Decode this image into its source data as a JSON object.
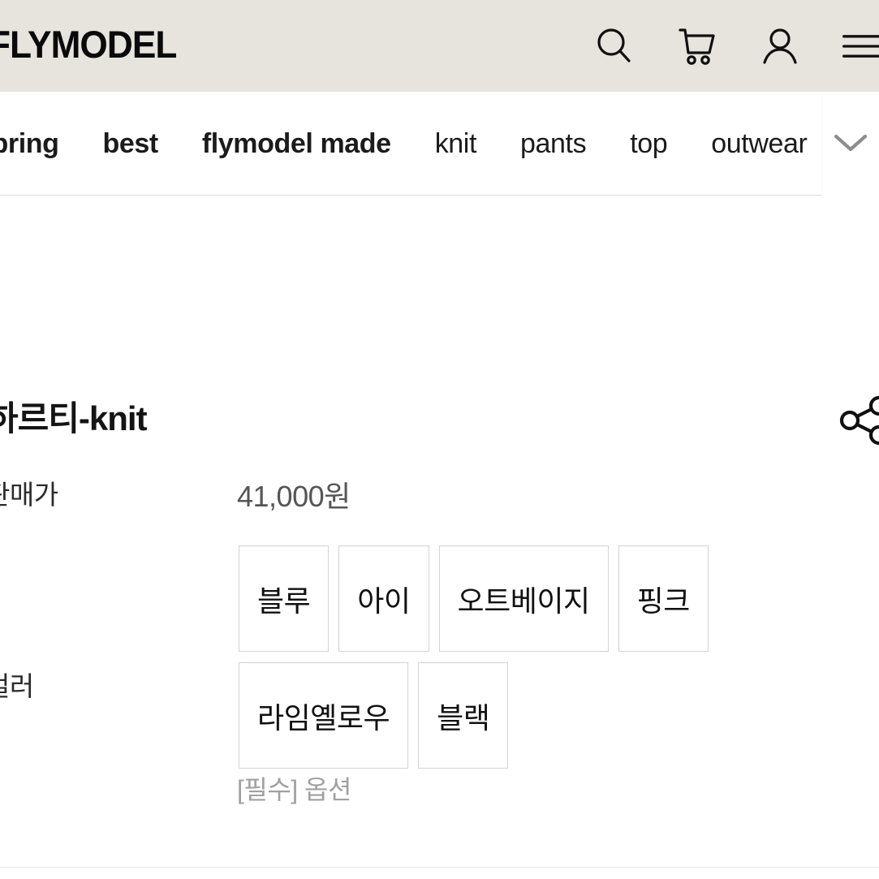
{
  "header": {
    "brand": "FLYMODEL",
    "background_color": "#e7e4dd",
    "icons": [
      {
        "name": "search-icon",
        "label": "Search"
      },
      {
        "name": "cart-icon",
        "label": "Cart"
      },
      {
        "name": "account-icon",
        "label": "My Account"
      },
      {
        "name": "menu-icon",
        "label": "Menu"
      }
    ]
  },
  "nav": {
    "items": [
      {
        "label": "spring",
        "bold": true
      },
      {
        "label": "best",
        "bold": true
      },
      {
        "label": "flymodel made",
        "bold": true
      },
      {
        "label": "knit",
        "bold": false
      },
      {
        "label": "pants",
        "bold": false
      },
      {
        "label": "top",
        "bold": false
      },
      {
        "label": "outwear",
        "bold": false
      }
    ],
    "expand_icon": "chevron-down-icon"
  },
  "product": {
    "title": "하르티-knit",
    "share_icon": "share-icon",
    "price_label": "판매가",
    "price_value": "41,000원",
    "color_label": "컬러",
    "color_options": [
      "블루",
      "아이",
      "오트베이지",
      "핑크",
      "라임옐로우",
      "블랙"
    ],
    "required_note": "[필수] 옵션"
  },
  "colors": {
    "header_bg": "#e7e4dd",
    "nav_bg": "rgba(255,255,255,0.86)",
    "text_primary": "#141414",
    "text_price": "#555555",
    "text_muted": "#a0a0a0",
    "option_border": "#d3d3d3"
  }
}
